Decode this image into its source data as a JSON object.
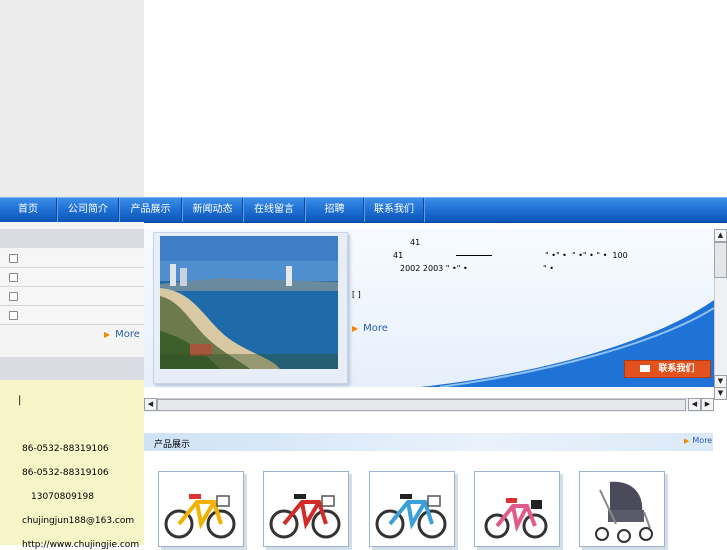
{
  "nav": {
    "items": [
      {
        "label": "首页"
      },
      {
        "label": "公司简介"
      },
      {
        "label": "产品展示"
      },
      {
        "label": "新闻动态"
      },
      {
        "label": "在线留言"
      },
      {
        "label": "招聘"
      },
      {
        "label": "联系我们"
      }
    ]
  },
  "sidebar": {
    "items": [
      {
        "label": ""
      },
      {
        "label": ""
      },
      {
        "label": ""
      },
      {
        "label": ""
      }
    ],
    "more_label": "More",
    "cursor_text": "|"
  },
  "contact": {
    "tel1": "86-0532-88319106",
    "tel2": "86-0532-88319106",
    "mobile": "13070809198",
    "email": "chujingjun188@163.com",
    "website": "http://www.chujingjie.com"
  },
  "intro": {
    "line1": "41",
    "line2a": "41",
    "line2b": "\" •\" •  \" •\" • \" •  100",
    "line3a": "2002 2003 \" •\" •",
    "line3b": "\" •",
    "brackets": "[ ]",
    "more_label": "More",
    "contact_button": "联系我们"
  },
  "products": {
    "title": "产品展示",
    "more_label": "More",
    "items": [
      {
        "name": "yellow-kids-bicycle"
      },
      {
        "name": "red-kids-bicycle"
      },
      {
        "name": "blue-kids-bicycle"
      },
      {
        "name": "pink-kids-bicycle"
      },
      {
        "name": "baby-stroller"
      }
    ]
  },
  "colors": {
    "nav_blue": "#1f6fd3",
    "accent_orange": "#f08a00",
    "link_blue": "#2a5aa8",
    "contact_bg": "#f7f5c8",
    "button_red": "#e3521c"
  }
}
